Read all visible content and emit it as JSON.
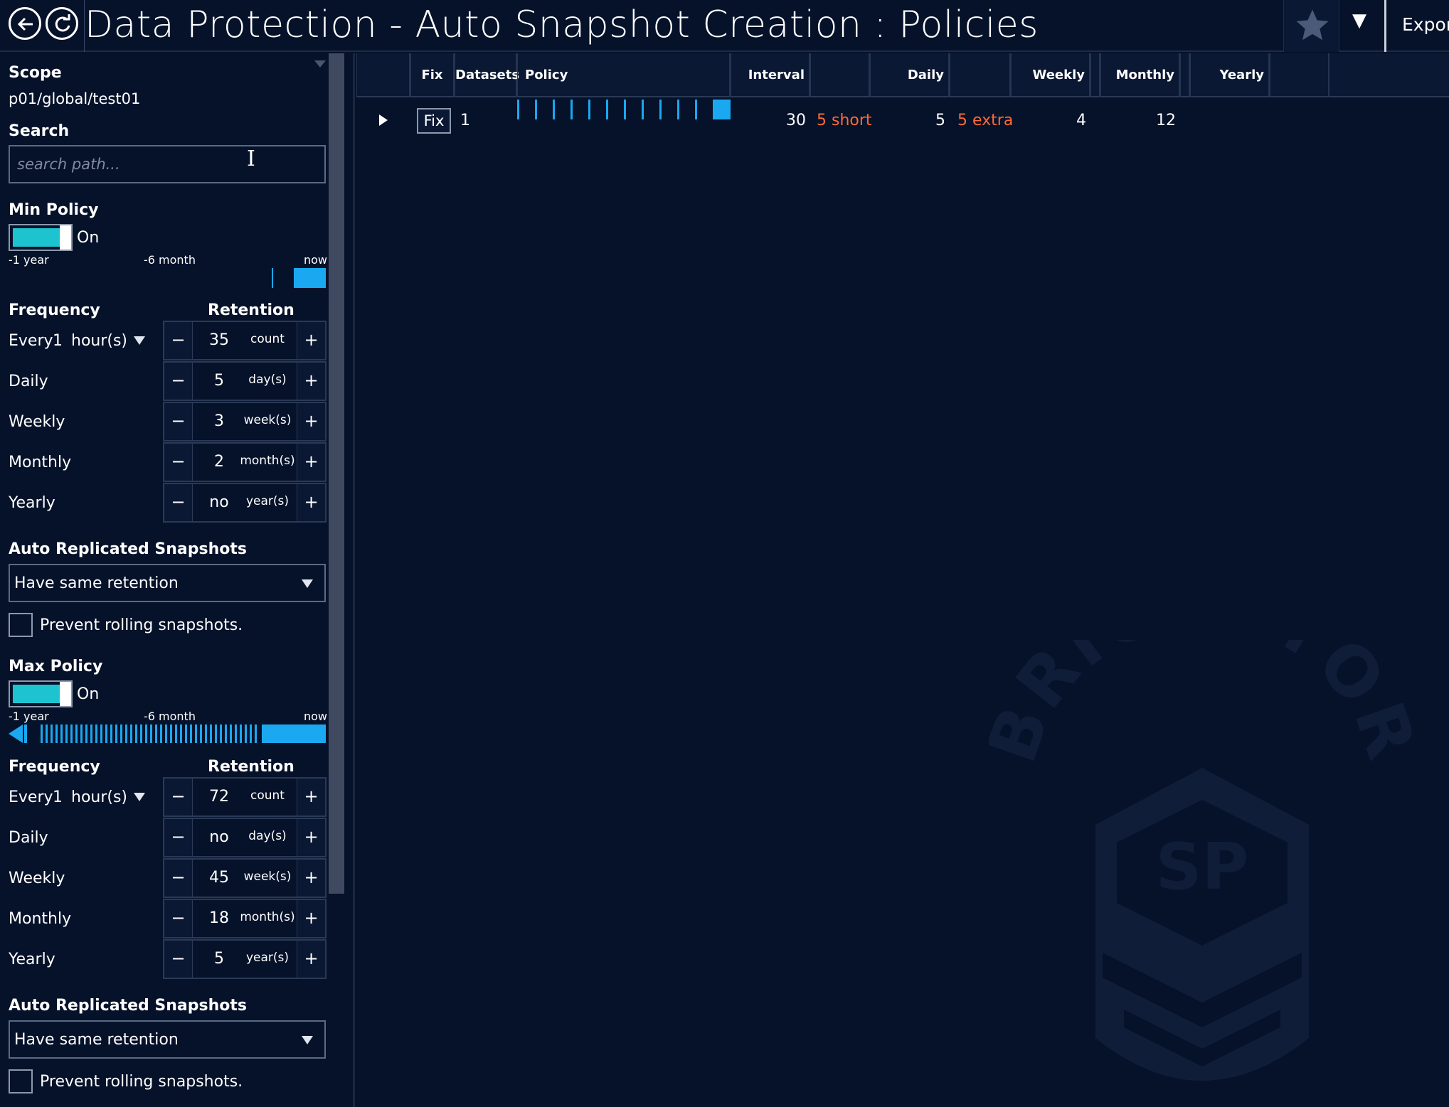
{
  "header": {
    "title": "Data Protection - Auto Snapshot Creation : Policies",
    "export_label": "Export",
    "back_icon": "back-icon",
    "refresh_icon": "refresh-icon",
    "star_icon": "star-icon",
    "dropdown_icon": "chevron-down-icon"
  },
  "sidebar": {
    "scope_label": "Scope",
    "scope_value": "p01/global/test01",
    "search_label": "Search",
    "search_placeholder": "search path...",
    "min_policy": {
      "label": "Min Policy",
      "toggle_state": "On",
      "timeline_labels": [
        "-1 year",
        "-6 month",
        "now"
      ],
      "frequency_label": "Frequency",
      "retention_label": "Retention",
      "rows": [
        {
          "label": "Every",
          "interval": "1",
          "interval_unit": "hour(s)",
          "value": "35",
          "unit": "count"
        },
        {
          "label": "Daily",
          "value": "5",
          "unit": "day(s)"
        },
        {
          "label": "Weekly",
          "value": "3",
          "unit": "week(s)"
        },
        {
          "label": "Monthly",
          "value": "2",
          "unit": "month(s)"
        },
        {
          "label": "Yearly",
          "value": "no",
          "unit": "year(s)"
        }
      ],
      "replicated_label": "Auto Replicated Snapshots",
      "replicated_value": "Have same retention",
      "prevent_label": "Prevent rolling snapshots."
    },
    "max_policy": {
      "label": "Max Policy",
      "toggle_state": "On",
      "timeline_labels": [
        "-1 year",
        "-6 month",
        "now"
      ],
      "frequency_label": "Frequency",
      "retention_label": "Retention",
      "rows": [
        {
          "label": "Every",
          "interval": "1",
          "interval_unit": "hour(s)",
          "value": "72",
          "unit": "count"
        },
        {
          "label": "Daily",
          "value": "no",
          "unit": "day(s)"
        },
        {
          "label": "Weekly",
          "value": "45",
          "unit": "week(s)"
        },
        {
          "label": "Monthly",
          "value": "18",
          "unit": "month(s)"
        },
        {
          "label": "Yearly",
          "value": "5",
          "unit": "year(s)"
        }
      ],
      "replicated_label": "Auto Replicated Snapshots",
      "replicated_value": "Have same retention",
      "prevent_label": "Prevent rolling snapshots."
    },
    "minus_symbol": "−",
    "plus_symbol": "+"
  },
  "table": {
    "columns": [
      "Fix",
      "Datasets",
      "Policy",
      "Interval",
      "Daily",
      "Weekly",
      "Monthly",
      "Yearly"
    ],
    "rows": [
      {
        "fix_label": "Fix",
        "datasets": "1",
        "interval": "30",
        "interval_note": "5 short",
        "daily": "5",
        "daily_note": "5 extra",
        "weekly": "4",
        "monthly": "12",
        "yearly": ""
      }
    ]
  },
  "colors": {
    "background": "#06122a",
    "accent": "#1ec3d0",
    "timeline": "#1aa8f0",
    "warning": "#ff6a35"
  },
  "watermark": {
    "brand": "BRICKSTOR",
    "badge": "SP"
  }
}
